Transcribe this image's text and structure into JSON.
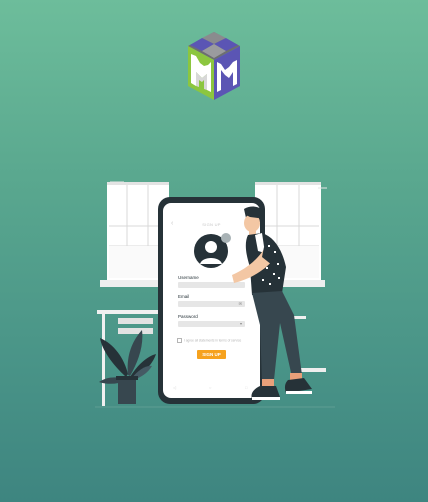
{
  "brand": {
    "logo_letters": "MM",
    "colors": {
      "logo_green": "#8cc63f",
      "logo_purple": "#5b55b4",
      "logo_gray": "#6d6e71",
      "logo_white": "#ffffff"
    }
  },
  "phone": {
    "screen_title": "SIGN UP",
    "fields": [
      {
        "label": "Username",
        "value": ""
      },
      {
        "label": "Email",
        "value": ""
      },
      {
        "label": "Password",
        "value": ""
      }
    ],
    "terms_text": "I agree all statements in terms of service",
    "signup_label": "SIGN UP",
    "icons": {
      "back": "back-arrow-icon",
      "avatar": "user-avatar-icon",
      "add_photo": "add-photo-icon",
      "email": "mail-icon",
      "password": "lock-icon"
    }
  },
  "colors": {
    "background_top": "#6dbd9b",
    "background_bottom": "#3e8580",
    "accent": "#f6a21e",
    "dark": "#263238"
  }
}
